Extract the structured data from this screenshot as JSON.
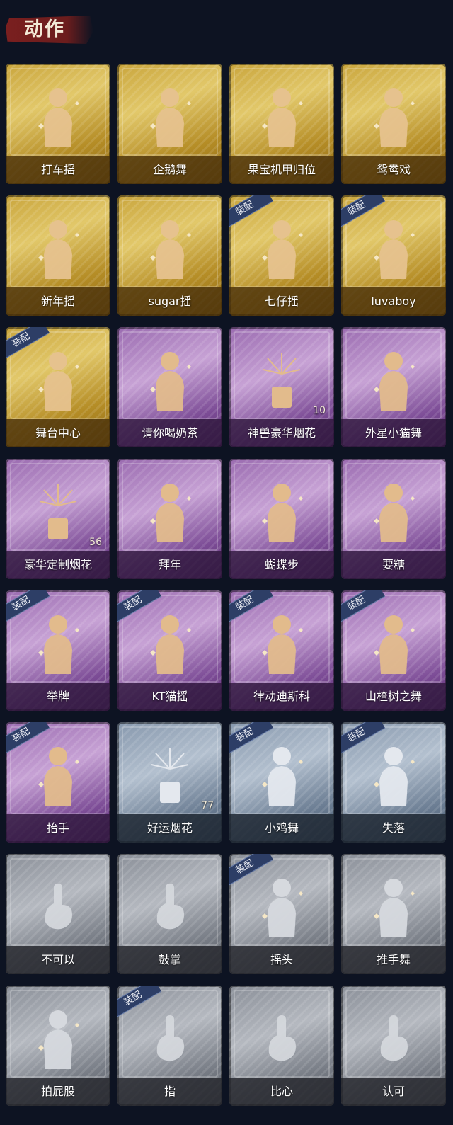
{
  "header": {
    "title": "动作"
  },
  "equipped_badge": "装配",
  "items": [
    {
      "label": "打车摇",
      "tier": "gold",
      "icon": "dance-pose-icon",
      "equipped": false
    },
    {
      "label": "企鹅舞",
      "tier": "gold",
      "icon": "dance-pose-icon",
      "equipped": false
    },
    {
      "label": "果宝机甲归位",
      "tier": "gold",
      "icon": "dance-pose-icon",
      "equipped": false
    },
    {
      "label": "鸳鸯戏",
      "tier": "gold",
      "icon": "dance-pose-icon",
      "equipped": false
    },
    {
      "label": "新年摇",
      "tier": "gold",
      "icon": "dance-pose-icon",
      "equipped": false
    },
    {
      "label": "sugar摇",
      "tier": "gold",
      "icon": "dance-pose-icon",
      "equipped": false
    },
    {
      "label": "七仔摇",
      "tier": "gold",
      "icon": "dance-pose-icon",
      "equipped": true
    },
    {
      "label": "luvaboy",
      "tier": "gold",
      "icon": "dance-pose-icon",
      "equipped": true
    },
    {
      "label": "舞台中心",
      "tier": "gold",
      "icon": "dance-pose-icon",
      "equipped": true
    },
    {
      "label": "请你喝奶茶",
      "tier": "purple",
      "icon": "banner-pose-icon",
      "equipped": false
    },
    {
      "label": "神兽豪华烟花",
      "tier": "purple",
      "icon": "fireworks-icon",
      "equipped": false,
      "count": "10"
    },
    {
      "label": "外星小猫舞",
      "tier": "purple",
      "icon": "dance-pose-icon",
      "equipped": false
    },
    {
      "label": "豪华定制烟花",
      "tier": "purple",
      "icon": "fireworks-box-icon",
      "equipped": false,
      "count": "56"
    },
    {
      "label": "拜年",
      "tier": "purple",
      "icon": "bow-pose-icon",
      "equipped": false
    },
    {
      "label": "蝴蝶步",
      "tier": "purple",
      "icon": "dance-pose-icon",
      "equipped": false
    },
    {
      "label": "要糖",
      "tier": "purple",
      "icon": "reach-pose-icon",
      "equipped": false
    },
    {
      "label": "举牌",
      "tier": "purple",
      "icon": "sign-pose-icon",
      "equipped": true
    },
    {
      "label": "KT猫摇",
      "tier": "purple",
      "icon": "dance-pose-icon",
      "equipped": true
    },
    {
      "label": "律动迪斯科",
      "tier": "purple",
      "icon": "dance-pose-icon",
      "equipped": true
    },
    {
      "label": "山楂树之舞",
      "tier": "purple",
      "icon": "dance-pose-icon",
      "equipped": true
    },
    {
      "label": "抬手",
      "tier": "purple",
      "icon": "raise-hand-icon",
      "equipped": true
    },
    {
      "label": "好运烟花",
      "tier": "blue",
      "icon": "fireworks-can-icon",
      "equipped": false,
      "count": "77"
    },
    {
      "label": "小鸡舞",
      "tier": "blue",
      "icon": "dance-pose-icon",
      "equipped": true
    },
    {
      "label": "失落",
      "tier": "blue",
      "icon": "crawl-pose-icon",
      "equipped": true
    },
    {
      "label": "不可以",
      "tier": "grey",
      "icon": "finger-wag-icon",
      "equipped": false
    },
    {
      "label": "鼓掌",
      "tier": "grey",
      "icon": "clap-hands-icon",
      "equipped": false
    },
    {
      "label": "摇头",
      "tier": "grey",
      "icon": "shake-head-icon",
      "equipped": true
    },
    {
      "label": "推手舞",
      "tier": "grey",
      "icon": "push-hands-icon",
      "equipped": false
    },
    {
      "label": "拍屁股",
      "tier": "grey",
      "icon": "pat-pose-icon",
      "equipped": false
    },
    {
      "label": "指",
      "tier": "grey",
      "icon": "point-hand-icon",
      "equipped": true
    },
    {
      "label": "比心",
      "tier": "grey",
      "icon": "finger-heart-icon",
      "equipped": false
    },
    {
      "label": "认可",
      "tier": "grey",
      "icon": "thumbs-up-icon",
      "equipped": false
    }
  ]
}
